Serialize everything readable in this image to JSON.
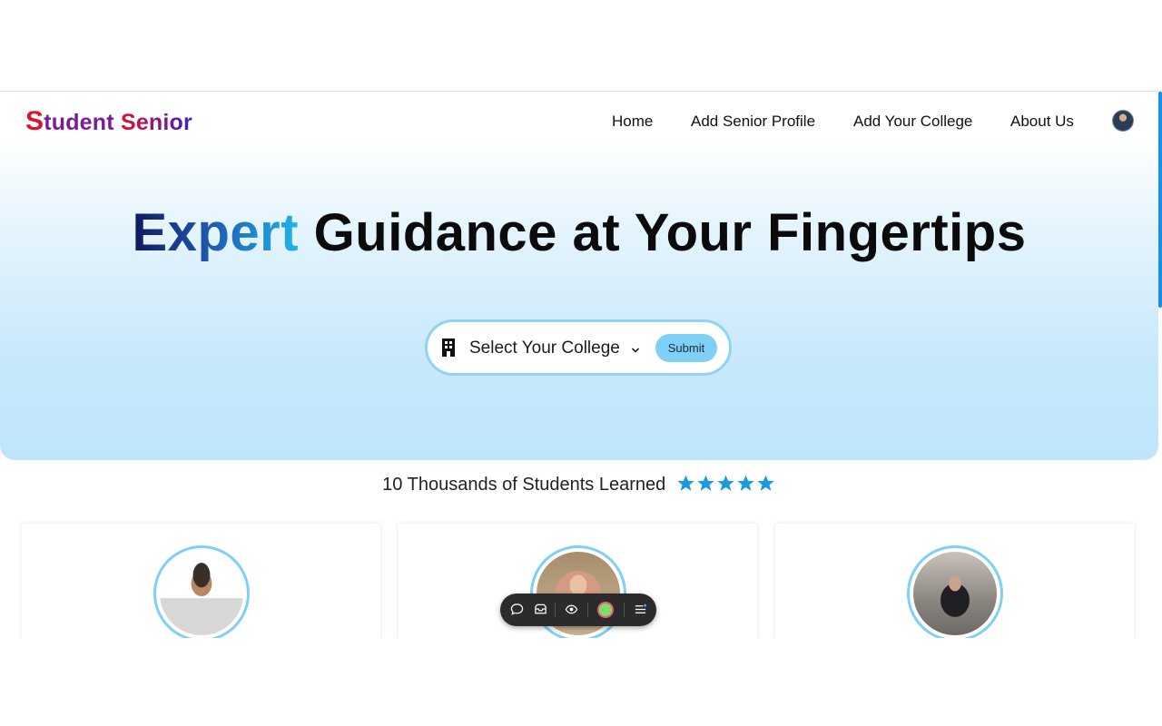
{
  "brand": {
    "first_letter": "S",
    "rest_first_word": "tudent",
    "second_word": "Senior"
  },
  "nav": {
    "items": [
      {
        "label": "Home"
      },
      {
        "label": "Add Senior Profile"
      },
      {
        "label": "Add Your College"
      },
      {
        "label": "About Us"
      }
    ]
  },
  "hero": {
    "headline_accent": "Expert",
    "headline_rest": "Guidance at Your Fingertips"
  },
  "search": {
    "select_label": "Select Your College",
    "submit_label": "Submit"
  },
  "stats": {
    "learned_text": "10 Thousands of Students Learned",
    "rating": 5,
    "rating_max": 5
  },
  "colors": {
    "brand_red": "#e0102a",
    "brand_blue": "#3b1fd1",
    "accent_blue": "#1fb4ea",
    "star_blue": "#1a9be0",
    "ring_blue": "#7fd0f6"
  },
  "icons": {
    "select_icon": "building-icon",
    "dropdown_icon": "chevron-down-icon",
    "rating_icon": "star-icon",
    "toolbar": [
      "chat-bubble-icon",
      "inbox-icon",
      "eye-icon",
      "color-dot-icon",
      "menu-icon"
    ]
  }
}
